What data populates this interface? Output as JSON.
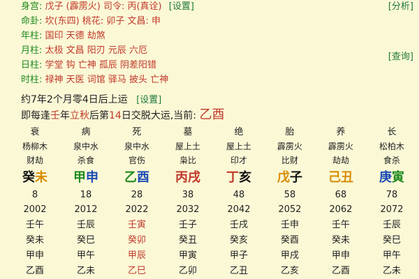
{
  "info_rows": [
    {
      "label": "身宫:",
      "value": "戊子 (霹雳火)",
      "extra": "司令: 丙(真诠)",
      "link": "[设置]"
    },
    {
      "label": "命卦:",
      "value": "坎(东四) 桃花: 卯子 文昌: 申",
      "extra": "",
      "link": ""
    },
    {
      "label": "年柱:",
      "value": "国印 天德 劫煞",
      "extra": "",
      "link": ""
    },
    {
      "label": "月柱:",
      "value": "太极 文昌 阳刃 元辰 六厄",
      "extra": "",
      "link": ""
    },
    {
      "label": "日柱:",
      "value": "学堂 钩 亡神 孤辰 阴差阳错",
      "extra": "",
      "link": ""
    },
    {
      "label": "时柱:",
      "value": "禄神 天医 词馆 驿马 披头 亡神",
      "extra": "",
      "link": ""
    }
  ],
  "right_links": {
    "analyze": "[分析]",
    "query": "[查询]"
  },
  "yun": {
    "text": "约7年2个月零4日后上运",
    "link": "[设置]"
  },
  "jiao": {
    "pre": "即每逢",
    "a": "壬",
    "b": "年",
    "c": "立秋",
    "d": "后第",
    "e": "14",
    "f": "日交脱大运,当前:",
    "current": "乙酉"
  },
  "columns": [
    {
      "stage": "衰",
      "nayin": "杨柳木",
      "shen": "财劫",
      "g1": "癸",
      "g2": "未",
      "age": "8",
      "year": "2002",
      "y": [
        "壬午",
        "癸未",
        "甲申",
        "乙酉"
      ]
    },
    {
      "stage": "病",
      "nayin": "泉中水",
      "shen": "杀食",
      "g1": "甲",
      "g2": "申",
      "age": "18",
      "year": "2012",
      "y": [
        "壬辰",
        "癸巳",
        "甲午",
        "乙未"
      ]
    },
    {
      "stage": "死",
      "nayin": "泉中水",
      "shen": "官伤",
      "g1": "乙",
      "g2": "酉",
      "age": "28",
      "year": "2022",
      "y": [
        "壬寅",
        "癸卯",
        "甲辰",
        "乙巳"
      ]
    },
    {
      "stage": "墓",
      "nayin": "屋上土",
      "shen": "枭比",
      "g1": "丙",
      "g2": "戌",
      "age": "38",
      "year": "2032",
      "y": [
        "壬子",
        "癸丑",
        "甲寅",
        "乙卯"
      ]
    },
    {
      "stage": "绝",
      "nayin": "屋上土",
      "shen": "印才",
      "g1": "丁",
      "g2": "亥",
      "age": "48",
      "year": "2042",
      "y": [
        "壬戌",
        "癸亥",
        "甲子",
        "乙丑"
      ]
    },
    {
      "stage": "胎",
      "nayin": "霹雳火",
      "shen": "比财",
      "g1": "戊",
      "g2": "子",
      "age": "58",
      "year": "2052",
      "y": [
        "壬申",
        "癸酉",
        "甲戌",
        "乙亥"
      ]
    },
    {
      "stage": "养",
      "nayin": "霹雳火",
      "shen": "劫劫",
      "g1": "己",
      "g2": "丑",
      "age": "68",
      "year": "2062",
      "y": [
        "壬午",
        "癸未",
        "甲申",
        "乙酉"
      ]
    },
    {
      "stage": "长",
      "nayin": "松柏木",
      "shen": "食杀",
      "g1": "庚",
      "g2": "寅",
      "age": "78",
      "year": "2072",
      "y": [
        "壬辰",
        "癸巳",
        "甲午",
        "乙未"
      ]
    }
  ]
}
